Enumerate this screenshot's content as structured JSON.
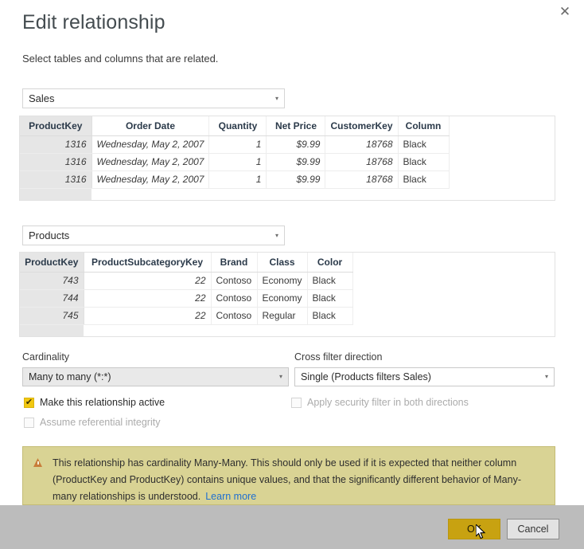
{
  "dialog": {
    "title": "Edit relationship",
    "subtitle": "Select tables and columns that are related.",
    "close_label": "✕"
  },
  "tables": [
    {
      "name": "sales",
      "selected_table": "Sales",
      "caret": "▾",
      "selected_column": "ProductKey",
      "columns": [
        "ProductKey",
        "Order Date",
        "Quantity",
        "Net Price",
        "CustomerKey",
        "Column"
      ],
      "rows": [
        [
          "1316",
          "Wednesday, May 2, 2007",
          "1",
          "$9.99",
          "18768",
          "Black"
        ],
        [
          "1316",
          "Wednesday, May 2, 2007",
          "1",
          "$9.99",
          "18768",
          "Black"
        ],
        [
          "1316",
          "Wednesday, May 2, 2007",
          "1",
          "$9.99",
          "18768",
          "Black"
        ]
      ]
    },
    {
      "name": "products",
      "selected_table": "Products",
      "caret": "▾",
      "selected_column": "ProductKey",
      "columns": [
        "ProductKey",
        "ProductSubcategoryKey",
        "Brand",
        "Class",
        "Color"
      ],
      "rows": [
        [
          "743",
          "22",
          "Contoso",
          "Economy",
          "Black"
        ],
        [
          "744",
          "22",
          "Contoso",
          "Economy",
          "Black"
        ],
        [
          "745",
          "22",
          "Contoso",
          "Regular",
          "Black"
        ]
      ]
    }
  ],
  "options": {
    "cardinality_label": "Cardinality",
    "cardinality_value": "Many to many (*:*)",
    "crossfilter_label": "Cross filter direction",
    "crossfilter_value": "Single (Products filters Sales)",
    "caret": "▾",
    "make_active_label": "Make this relationship active",
    "make_active_checked": true,
    "assume_ri_label": "Assume referential integrity",
    "assume_ri_checked": false,
    "apply_security_label": "Apply security filter in both directions",
    "apply_security_checked": false,
    "tick": "✔"
  },
  "warning": {
    "text": "This relationship has cardinality Many-Many. This should only be used if it is expected that neither column (ProductKey and ProductKey) contains unique values, and that the significantly different behavior of Many-many relationships is understood.",
    "link_label": "Learn more",
    "background": "#d9d394",
    "icon_color": "#c87d3a"
  },
  "footer": {
    "ok_label": "OK",
    "cancel_label": "Cancel",
    "ok_color": "#c8a211",
    "background": "#bcbcbc"
  },
  "accent": {
    "checkbox_checked": "#f2c811",
    "link": "#1f6fd0"
  }
}
